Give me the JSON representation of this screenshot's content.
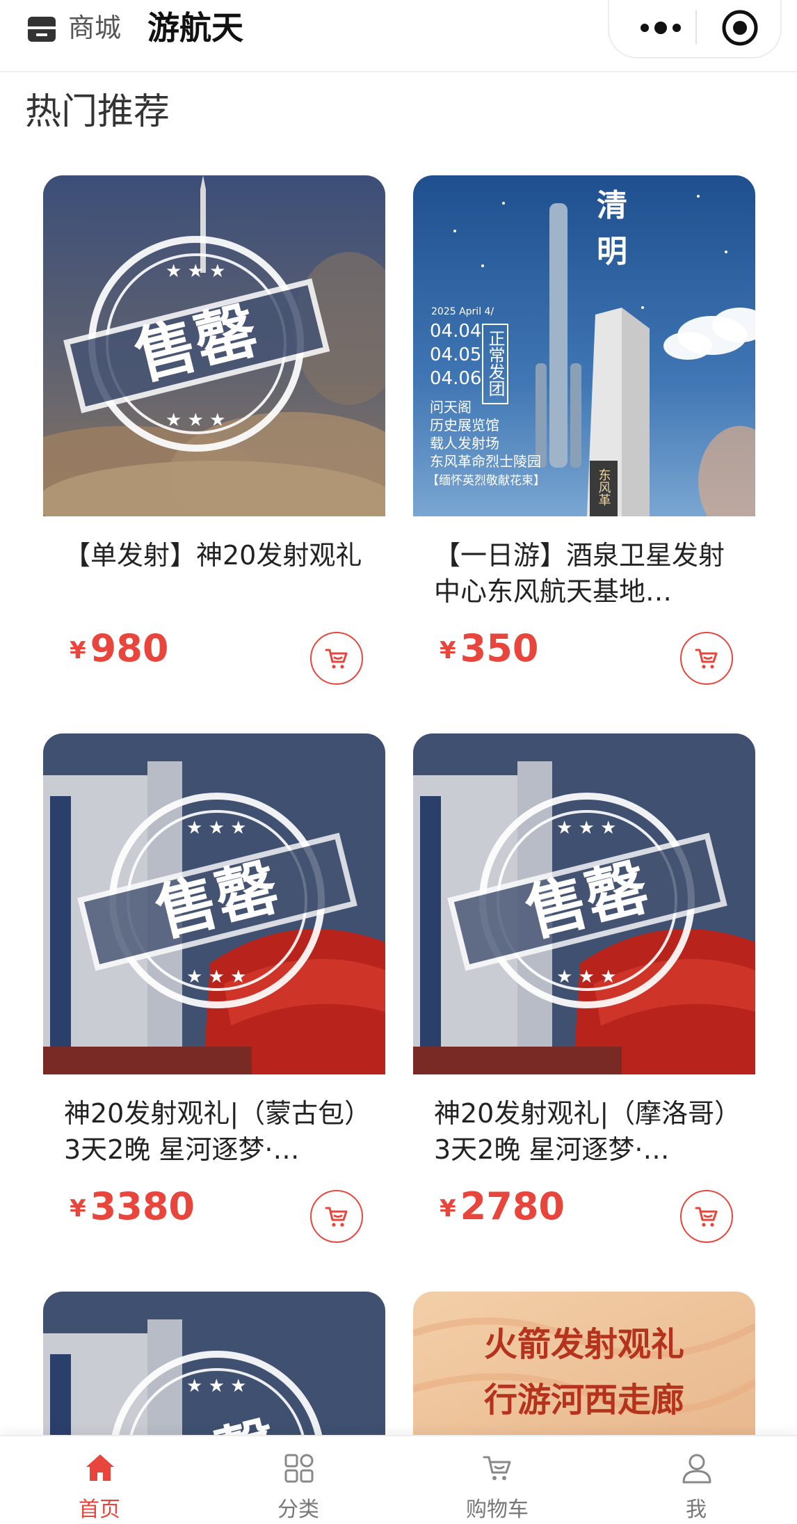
{
  "header": {
    "shop_label": "商城",
    "app_title": "游航天"
  },
  "section_title": "热门推荐",
  "theme": {
    "accent": "#e8453c"
  },
  "products": [
    {
      "name": "【单发射】神20发射观礼",
      "currency": "¥",
      "price": "980",
      "image": {
        "kind": "sold-out-stamp",
        "stamp_text": "售罄",
        "scene": "rocket-launch-smoke"
      }
    },
    {
      "name": "【一日游】酒泉卫星发射中心东风航天基地…",
      "currency": "¥",
      "price": "350",
      "image": {
        "kind": "poster",
        "title_top": "清",
        "title_bottom": "明",
        "date_header": "2025 April 4/",
        "dates": [
          "04.04",
          "04.05",
          "04.06"
        ],
        "badge": "正常发团",
        "itinerary": [
          "问天阁",
          "历史展览馆",
          "载人发射场",
          "东风革命烈士陵园",
          "【缅怀英烈敬献花束】"
        ],
        "monument_text": "东风革"
      }
    },
    {
      "name": "神20发射观礼|（蒙古包）3天2晚 星河逐梦·…",
      "currency": "¥",
      "price": "3380",
      "image": {
        "kind": "sold-out-stamp",
        "stamp_text": "售罄",
        "scene": "launch-tower-flag"
      }
    },
    {
      "name": "神20发射观礼|（摩洛哥）3天2晚 星河逐梦·…",
      "currency": "¥",
      "price": "2780",
      "image": {
        "kind": "sold-out-stamp",
        "stamp_text": "售罄",
        "scene": "launch-tower-flag"
      }
    },
    {
      "name": "",
      "currency": "",
      "price": "",
      "image": {
        "kind": "sold-out-stamp",
        "stamp_text": "售罄",
        "scene": "launch-tower-flag"
      }
    },
    {
      "name": "",
      "currency": "",
      "price": "",
      "image": {
        "kind": "banner",
        "line1": "火箭发射观礼",
        "line2": "行游河西走廊"
      }
    }
  ],
  "tabs": [
    {
      "label": "首页",
      "icon": "home-icon",
      "active": true
    },
    {
      "label": "分类",
      "icon": "category-icon",
      "active": false
    },
    {
      "label": "购物车",
      "icon": "cart-icon",
      "active": false
    },
    {
      "label": "我",
      "icon": "user-icon",
      "active": false
    }
  ]
}
